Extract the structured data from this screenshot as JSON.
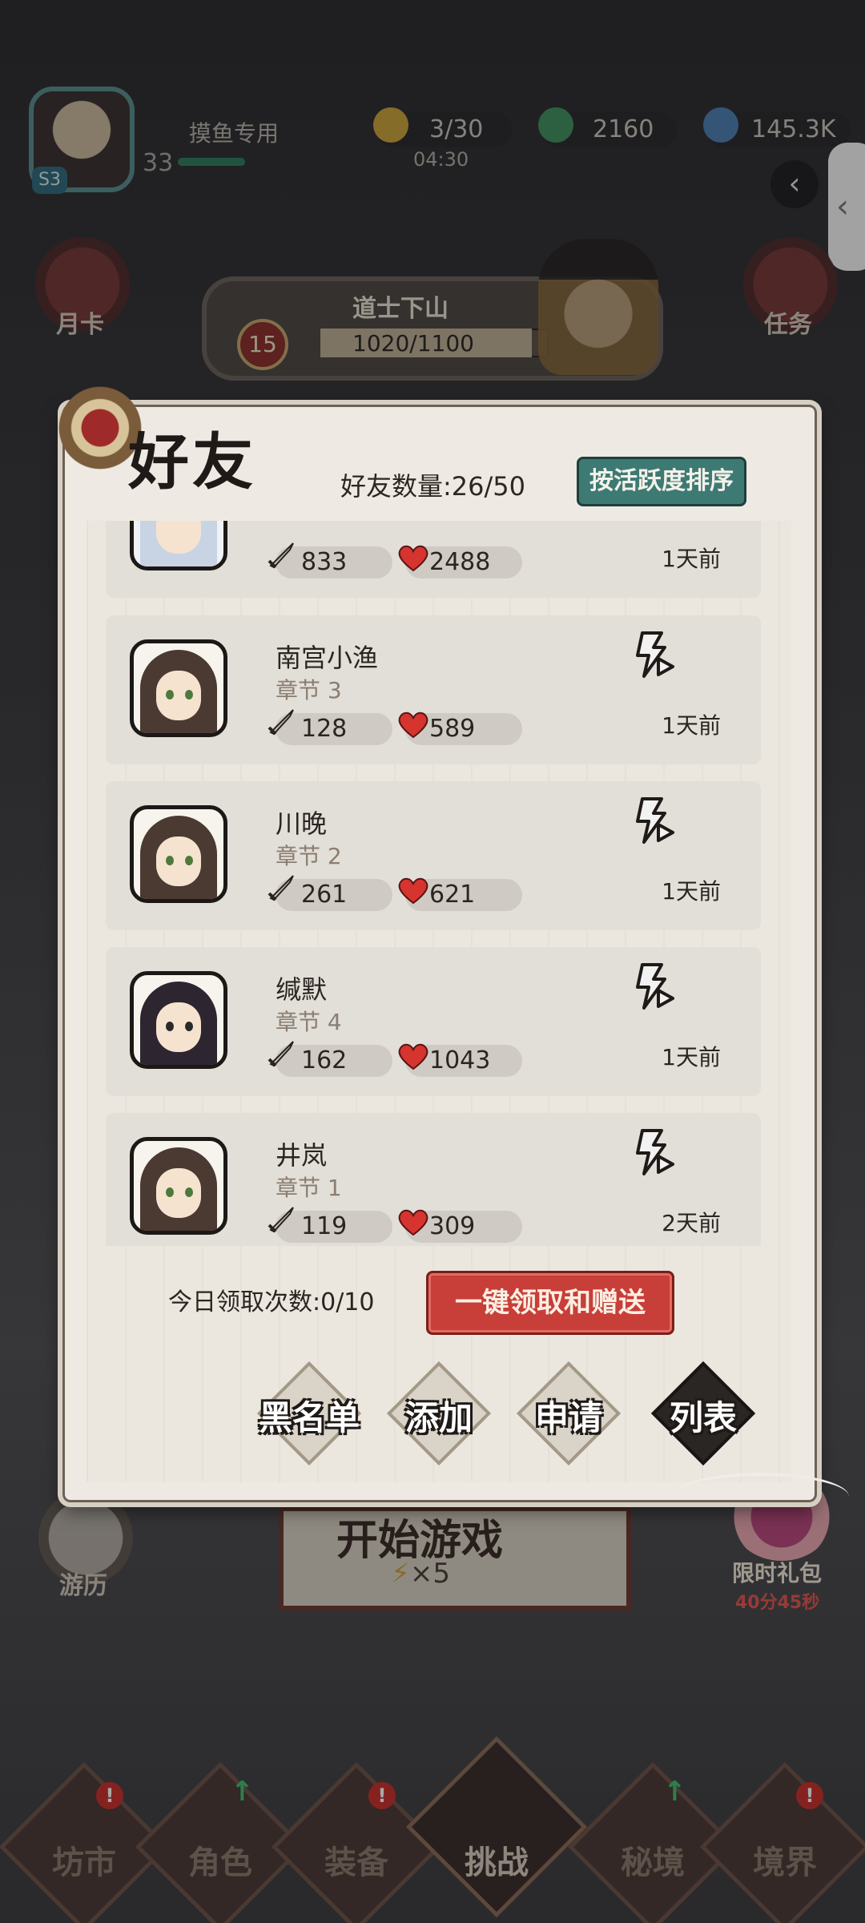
{
  "player": {
    "name": "摸鱼专用",
    "level": "33",
    "server_badge": "S3"
  },
  "resources": {
    "energy": "3/30",
    "energy_timer": "04:30",
    "jade": "2160",
    "crystal": "145.3K"
  },
  "side_buttons": {
    "left_top": "月卡",
    "right_top": "任务",
    "travel": "游历",
    "gift": "限时礼包",
    "gift_timer": "40分45秒"
  },
  "stage": {
    "level": "15",
    "name": "道士下山",
    "progress": "1020/1100",
    "progress_fraction": 0.927
  },
  "start_game": {
    "label": "开始游戏",
    "cost": "×5"
  },
  "bottom_nav": [
    {
      "label": "坊市",
      "badge": "!"
    },
    {
      "label": "角色",
      "badge": "up"
    },
    {
      "label": "装备",
      "badge": "!"
    },
    {
      "label": "挑战",
      "badge": ""
    },
    {
      "label": "秘境",
      "badge": "up"
    },
    {
      "label": "境界",
      "badge": "!"
    }
  ],
  "friends_modal": {
    "title": "好友",
    "count_label": "好友数量:26/50",
    "sort_button": "按活跃度排序",
    "friends": [
      {
        "name": "",
        "chapter": "",
        "power": "833",
        "hp": "2488",
        "last_online": "1天前",
        "avatar": "light"
      },
      {
        "name": "南宫小渔",
        "chapter": "章节 3",
        "power": "128",
        "hp": "589",
        "last_online": "1天前",
        "avatar": "girl"
      },
      {
        "name": "川晚",
        "chapter": "章节 2",
        "power": "261",
        "hp": "621",
        "last_online": "1天前",
        "avatar": "girl"
      },
      {
        "name": "缄默",
        "chapter": "章节 4",
        "power": "162",
        "hp": "1043",
        "last_online": "1天前",
        "avatar": "dark"
      },
      {
        "name": "井岚",
        "chapter": "章节 1",
        "power": "119",
        "hp": "309",
        "last_online": "2天前",
        "avatar": "girl"
      }
    ],
    "claim_count": "今日领取次数:0/10",
    "claim_button": "一键领取和赠送",
    "tabs": [
      {
        "label": "黑名单",
        "active": false
      },
      {
        "label": "添加",
        "active": false
      },
      {
        "label": "申请",
        "active": false
      },
      {
        "label": "列表",
        "active": true
      }
    ]
  }
}
